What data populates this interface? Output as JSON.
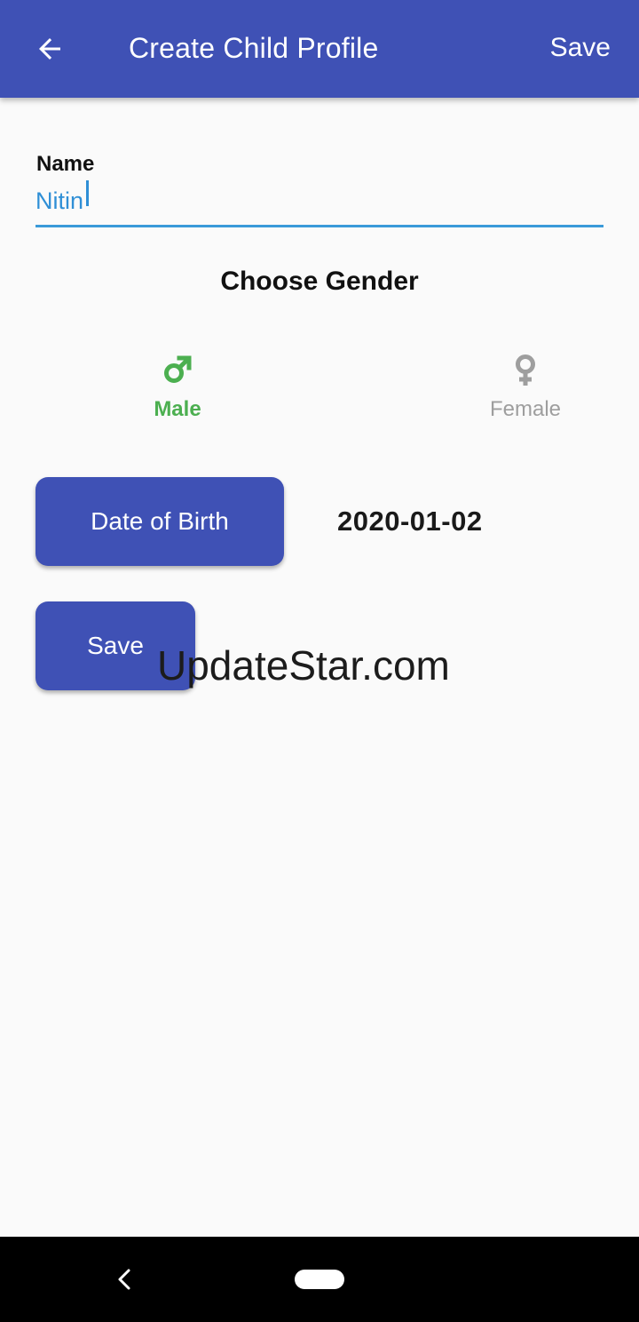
{
  "app_bar": {
    "title": "Create Child Profile",
    "save_label": "Save",
    "background": "#3f51b5"
  },
  "form": {
    "name_label": "Name",
    "name_value": "Nitin",
    "gender_title": "Choose Gender",
    "genders": [
      {
        "label": "Male",
        "icon": "male-symbol-icon",
        "selected": true,
        "color": "#4caf50"
      },
      {
        "label": "Female",
        "icon": "female-symbol-icon",
        "selected": false,
        "color": "#9e9e9e"
      }
    ],
    "dob_button_label": "Date of Birth",
    "dob_value": "2020-01-02",
    "save_button_label": "Save"
  },
  "watermark": "UpdateStar.com",
  "system_nav": {
    "back_icon": "chevron-left-icon",
    "home_icon": "home-pill-icon"
  }
}
